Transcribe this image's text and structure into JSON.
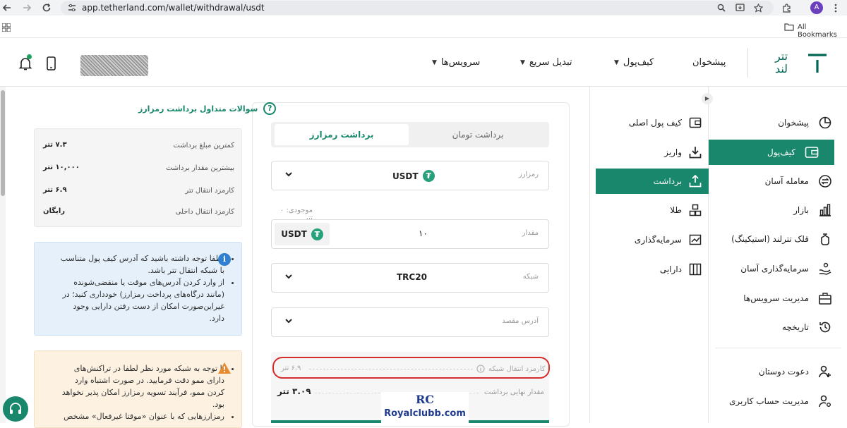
{
  "browser": {
    "url": "app.tetherland.com/wallet/withdrawal/usdt",
    "avatar_letter": "A",
    "bookmarks_label": "All Bookmarks"
  },
  "header": {
    "logo_text_line1": "تتر",
    "logo_text_line2": "لند",
    "nav": {
      "dashboard": "پیشخوان",
      "wallet": "کیف‌پول",
      "quick_swap": "تبدیل سریع",
      "services": "سرویس‌ها"
    }
  },
  "sidebar": {
    "items": [
      {
        "label": "پیشخوان",
        "icon": "pie-chart-icon"
      },
      {
        "label": "کیف‌پول",
        "icon": "wallet-icon",
        "active": true
      },
      {
        "label": "معامله آسان",
        "icon": "exchange-icon"
      },
      {
        "label": "بازار",
        "icon": "bar-chart-icon"
      },
      {
        "label": "قلک تترلند (استیکینگ)",
        "icon": "piggy-bank-icon"
      },
      {
        "label": "سرمایه‌گذاری آسان",
        "icon": "invest-hand-icon"
      },
      {
        "label": "مدیریت سرویس‌ها",
        "icon": "briefcase-icon"
      },
      {
        "label": "تاریخچه",
        "icon": "history-icon"
      }
    ],
    "bottom": [
      {
        "label": "دعوت دوستان",
        "icon": "invite-user-icon"
      },
      {
        "label": "مدیریت حساب کاربری",
        "icon": "user-settings-icon"
      }
    ]
  },
  "subnav": {
    "items": [
      {
        "label": "کیف پول اصلی",
        "icon": "wallet-icon"
      },
      {
        "label": "واریز",
        "icon": "deposit-icon"
      },
      {
        "label": "برداشت",
        "icon": "withdraw-icon",
        "active": true
      },
      {
        "label": "طلا",
        "icon": "gold-bars-icon"
      },
      {
        "label": "سرمایه‌گذاری",
        "icon": "chart-trend-icon"
      },
      {
        "label": "دارایی",
        "icon": "assets-icon"
      }
    ]
  },
  "form": {
    "tab_crypto": "برداشت رمزارز",
    "tab_toman": "برداشت تومان",
    "crypto_label": "رمزارز",
    "crypto_value": "USDT",
    "balance_text": "موجودی: ۰ تتر",
    "amount_label": "مقدار",
    "amount_value": "۱۰",
    "amount_coin": "USDT",
    "network_label": "شبکه",
    "network_value": "TRC20",
    "address_placeholder": "آدرس مقصد",
    "network_fee_label": "کارمزد انتقال شبکه",
    "network_fee_value": "۶.۹ تتر",
    "final_amount_label": "مقدار نهایی برداشت",
    "final_amount_value": "۳.۰۹ تتر"
  },
  "info": {
    "faq_title": "سوالات متداول برداشت رمزارز",
    "rows": [
      {
        "label": "کمترین مبلغ برداشت",
        "value": "۷.۳ تتر"
      },
      {
        "label": "بیشترین مقدار برداشت",
        "value": "۱۰,۰۰۰ تتر"
      },
      {
        "label": "کارمزد انتقال تتر",
        "value": "۶.۹ تتر"
      },
      {
        "label": "کارمزد انتقال داخلی",
        "value": "رایگان"
      }
    ],
    "blue_note_1": "لطفا توجه داشته باشید که آدرس کیف پول متناسب با شبکه انتقال تتر باشد.",
    "blue_note_2": "از وارد کردن آدرس‌های موقت یا منقضی‌شونده (مانند درگاه‌های پرداخت رمزارز) خودداری کنید؛ در غیراین‌صورت امکان از دست رفتن دارایی وجود دارد.",
    "warn_note_1": "با توجه به شبکه مورد نظر لطفا در تراکنش‌های دارای ممو دقت فرمایید. در صورت اشتباه وارد کردن ممو، فرآیند تسویه رمزارز امکان پذیر نخواهد بود.",
    "warn_note_2": "رمزارزهایی که با عنوان «موقتا غیرفعال» مشخص"
  },
  "watermark": {
    "mark": "RC",
    "text": "Royalclubb.com"
  },
  "colors": {
    "brand": "#18876b",
    "highlight_oval": "#d62b2b",
    "info_blue": "#2f80d3"
  }
}
